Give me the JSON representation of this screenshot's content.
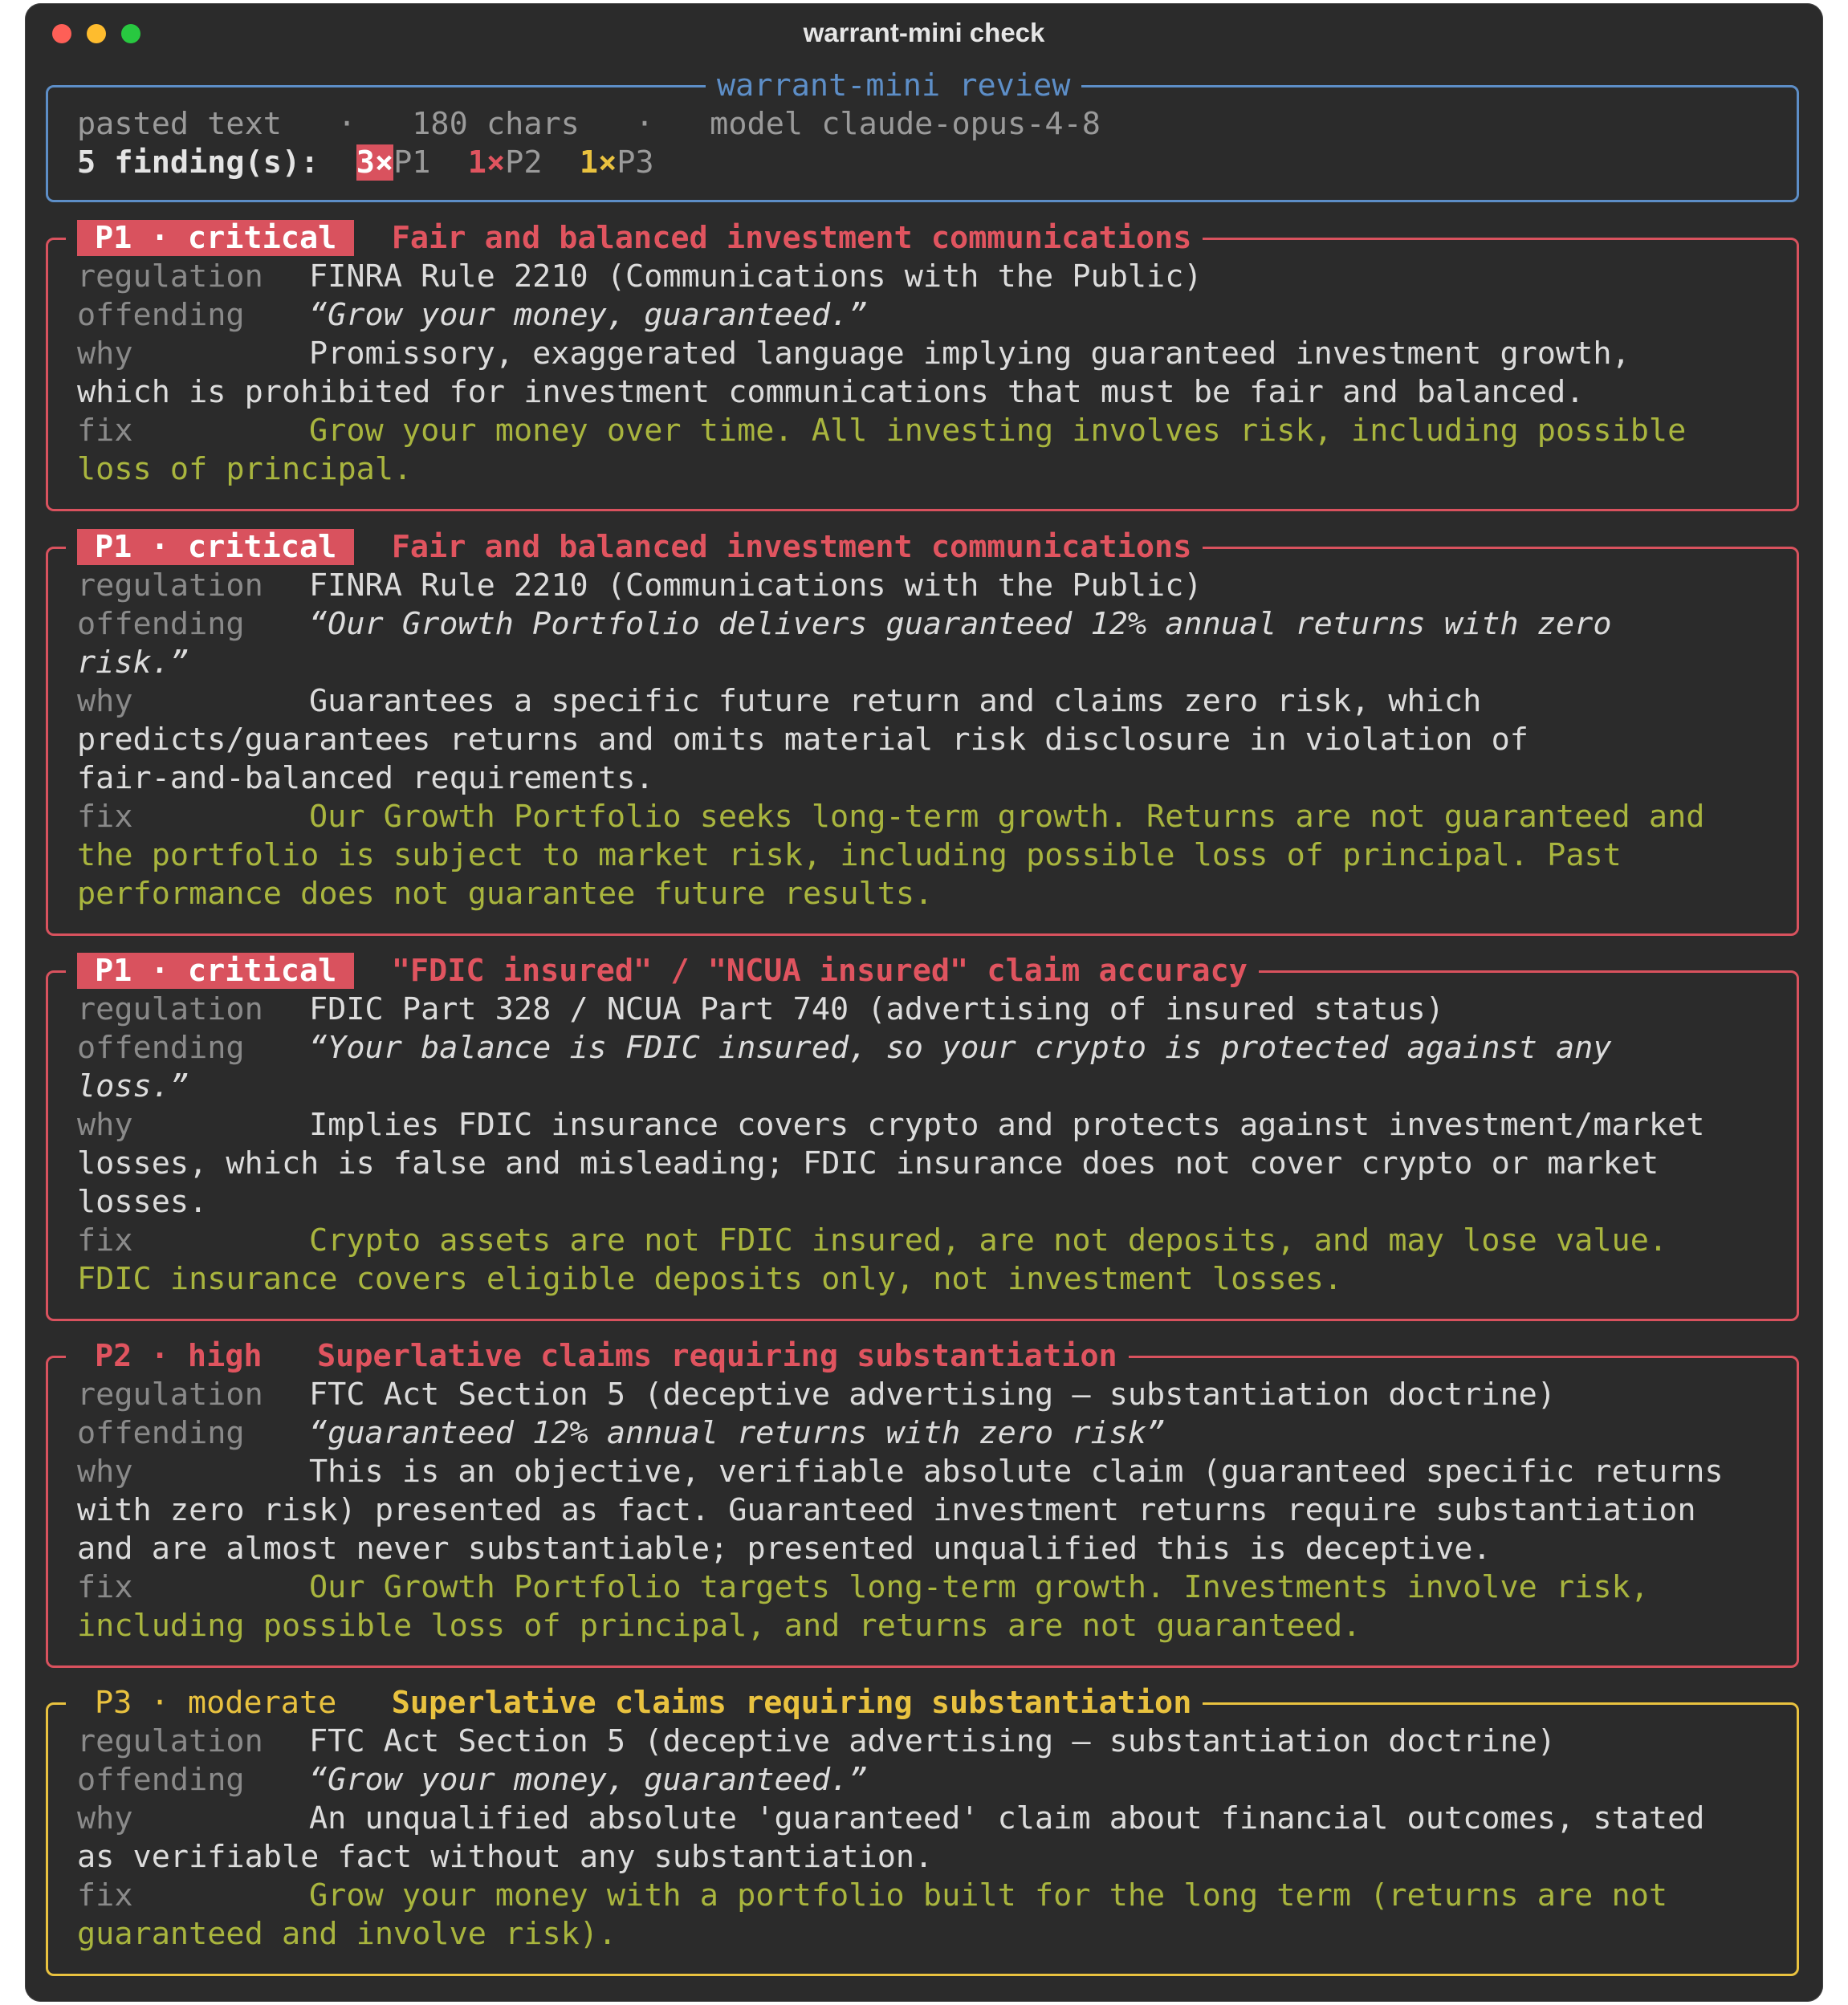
{
  "window": {
    "title": "warrant-mini check"
  },
  "colors": {
    "critical": "#d9525e",
    "moderate": "#e9c23f",
    "fix": "#a9b53e",
    "header_border": "#5d8ec7"
  },
  "header": {
    "legend": "warrant-mini review",
    "source": "pasted text",
    "sep": "·",
    "chars": "180 chars",
    "model": "model claude-opus-4-8",
    "findings_label": "5 finding(s):",
    "counts": [
      {
        "count": "3",
        "times": "×",
        "level": "P1"
      },
      {
        "count": "1",
        "times": "×",
        "level": "P2"
      },
      {
        "count": "1",
        "times": "×",
        "level": "P3"
      }
    ]
  },
  "labels": {
    "regulation": "regulation",
    "offending": "offending",
    "why": "why",
    "fix": "fix"
  },
  "findings": [
    {
      "priority": "P1 · critical",
      "title": "Fair and balanced investment communications",
      "regulation": "FINRA Rule 2210 (Communications with the Public)",
      "offending": [
        "“Grow your money, guaranteed.”"
      ],
      "why": [
        "Promissory, exaggerated language implying guaranteed investment growth,",
        "which is prohibited for investment communications that must be fair and balanced."
      ],
      "fix": [
        "Grow your money over time. All investing involves risk, including possible",
        "loss of principal."
      ]
    },
    {
      "priority": "P1 · critical",
      "title": "Fair and balanced investment communications",
      "regulation": "FINRA Rule 2210 (Communications with the Public)",
      "offending": [
        "“Our Growth Portfolio delivers guaranteed 12% annual returns with zero",
        "risk.”"
      ],
      "why": [
        "Guarantees a specific future return and claims zero risk, which",
        "predicts/guarantees returns and omits material risk disclosure in violation of",
        "fair-and-balanced requirements."
      ],
      "fix": [
        "Our Growth Portfolio seeks long-term growth. Returns are not guaranteed and",
        "the portfolio is subject to market risk, including possible loss of principal. Past",
        "performance does not guarantee future results."
      ]
    },
    {
      "priority": "P1 · critical",
      "title": "\"FDIC insured\" / \"NCUA insured\" claim accuracy",
      "regulation": "FDIC Part 328 / NCUA Part 740 (advertising of insured status)",
      "offending": [
        "“Your balance is FDIC insured, so your crypto is protected against any",
        "loss.”"
      ],
      "why": [
        "Implies FDIC insurance covers crypto and protects against investment/market",
        "losses, which is false and misleading; FDIC insurance does not cover crypto or market",
        "losses."
      ],
      "fix": [
        "Crypto assets are not FDIC insured, are not deposits, and may lose value.",
        "FDIC insurance covers eligible deposits only, not investment losses."
      ]
    },
    {
      "priority": "P2 · high",
      "title": "Superlative claims requiring substantiation",
      "regulation": "FTC Act Section 5 (deceptive advertising — substantiation doctrine)",
      "offending": [
        "“guaranteed 12% annual returns with zero risk”"
      ],
      "why": [
        "This is an objective, verifiable absolute claim (guaranteed specific returns",
        "with zero risk) presented as fact. Guaranteed investment returns require substantiation",
        "and are almost never substantiable; presented unqualified this is deceptive."
      ],
      "fix": [
        "Our Growth Portfolio targets long-term growth. Investments involve risk,",
        "including possible loss of principal, and returns are not guaranteed."
      ]
    },
    {
      "priority": "P3 · moderate",
      "title": "Superlative claims requiring substantiation",
      "regulation": "FTC Act Section 5 (deceptive advertising — substantiation doctrine)",
      "offending": [
        "“Grow your money, guaranteed.”"
      ],
      "why": [
        "An unqualified absolute 'guaranteed' claim about financial outcomes, stated",
        "as verifiable fact without any substantiation."
      ],
      "fix": [
        "Grow your money with a portfolio built for the long term (returns are not",
        "guaranteed and involve risk)."
      ]
    }
  ]
}
